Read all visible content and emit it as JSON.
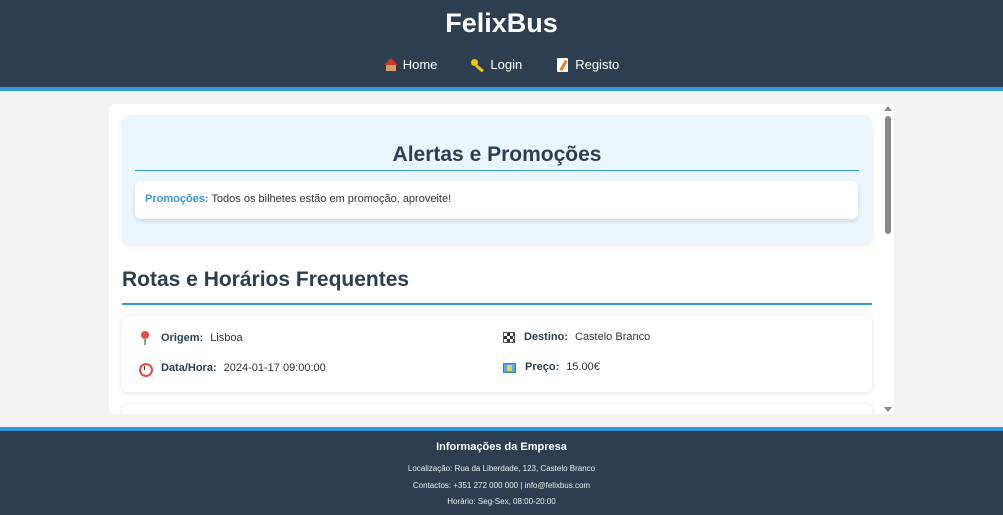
{
  "header": {
    "title": "FelixBus",
    "nav": [
      {
        "label": "Home",
        "icon": "house-icon"
      },
      {
        "label": "Login",
        "icon": "key-icon"
      },
      {
        "label": "Registo",
        "icon": "memo-icon"
      }
    ]
  },
  "alerts": {
    "title": "Alertas e Promoções",
    "promo_label": "Promoções:",
    "promo_text": " Todos os bilhetes estão em promoção, aproveite!"
  },
  "routes": {
    "title": "Rotas e Horários Frequentes",
    "items": [
      {
        "origin_label": "Origem:",
        "origin": "Lisboa",
        "destination_label": "Destino:",
        "destination": "Castelo Branco",
        "datetime_label": "Data/Hora:",
        "datetime": "2024-01-17 09:00:00",
        "price_label": "Preço:",
        "price": "15.00€"
      }
    ]
  },
  "footer": {
    "title": "Informações da Empresa",
    "location": "Localização: Rua da Liberdade, 123, Castelo Branco",
    "contacts": "Contactos: +351 272 000 000 | info@felixbus.com",
    "hours": "Horário: Seg-Sex, 08:00-20:00"
  },
  "colors": {
    "header_bg": "#2c3e50",
    "accent": "#3498db",
    "alert_bg": "#eaf5fd"
  }
}
